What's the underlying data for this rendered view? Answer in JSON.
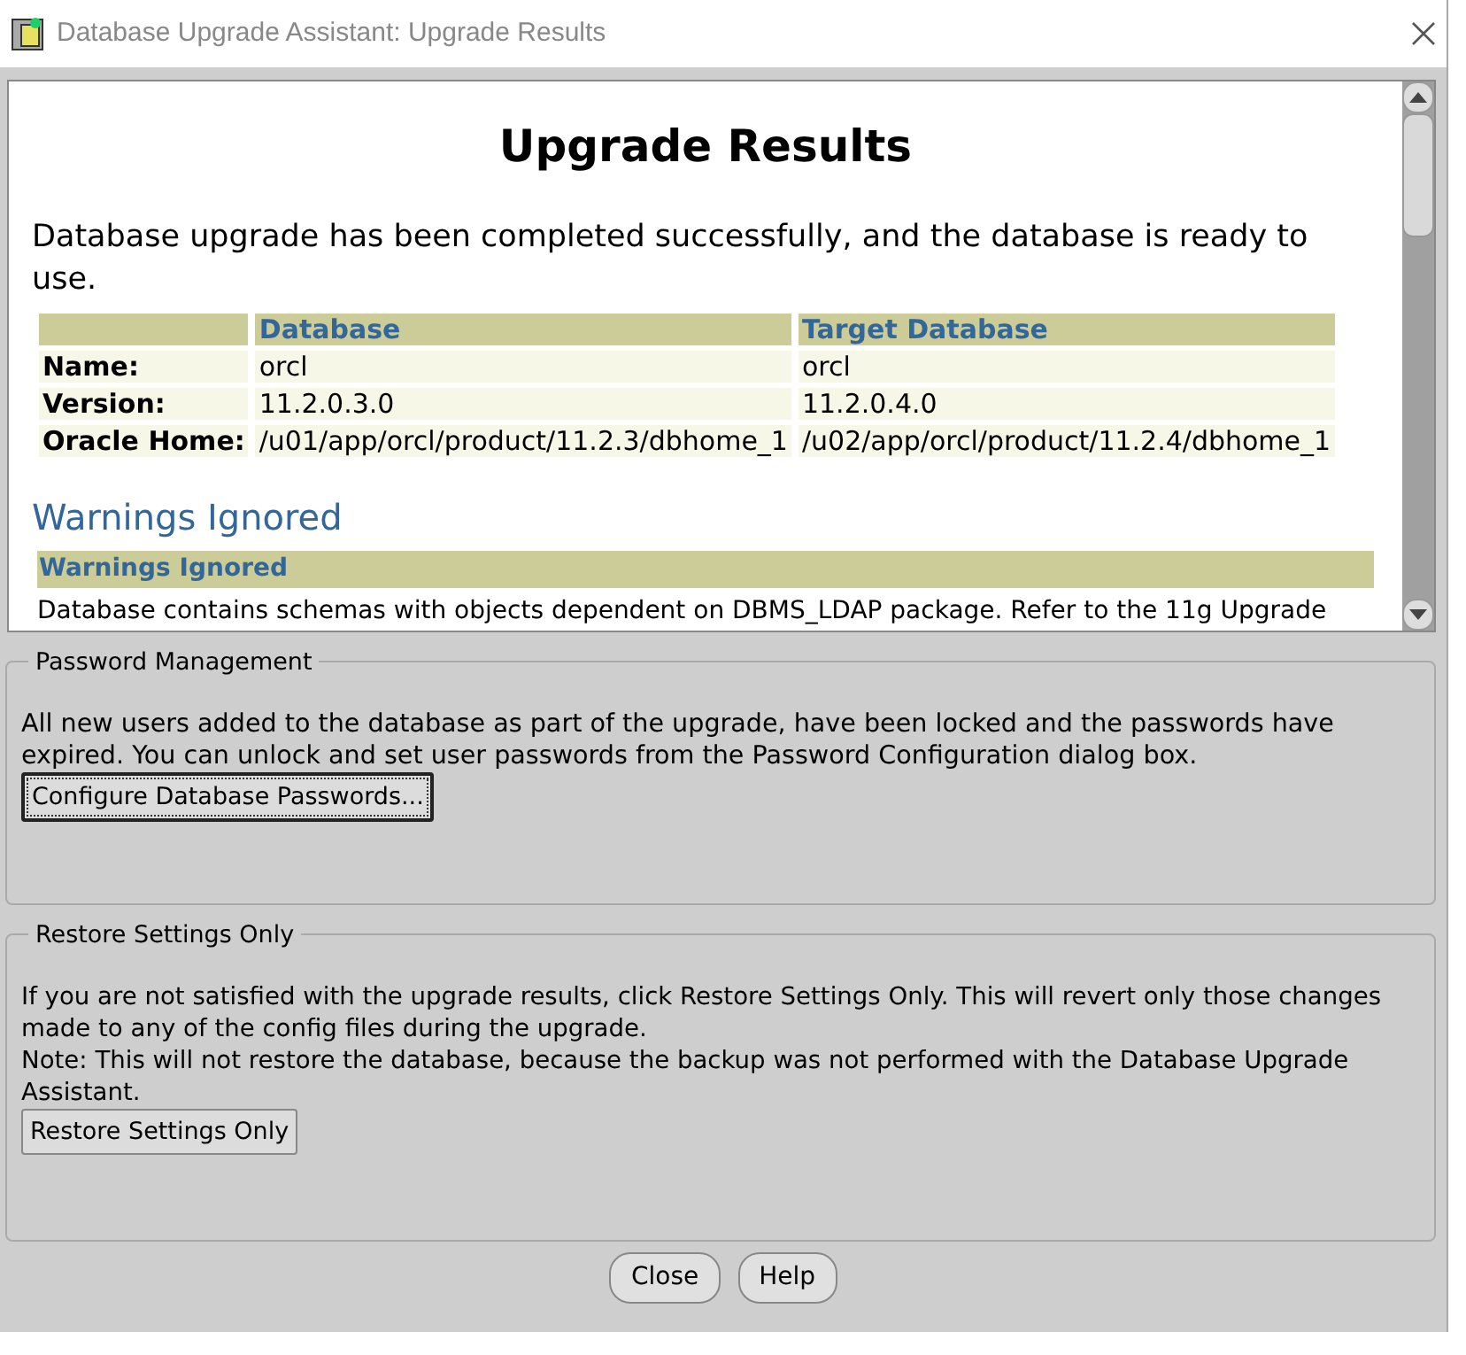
{
  "window": {
    "title": "Database Upgrade Assistant: Upgrade Results"
  },
  "results": {
    "heading": "Upgrade Results",
    "summary": "Database upgrade has been completed successfully, and the database is ready to use.",
    "table": {
      "columns": [
        "Database",
        "Target Database"
      ],
      "rows": [
        {
          "label": "Name:",
          "values": [
            "orcl",
            "orcl"
          ]
        },
        {
          "label": "Version:",
          "values": [
            "11.2.0.3.0",
            "11.2.0.4.0"
          ]
        },
        {
          "label": "Oracle Home:",
          "values": [
            "/u01/app/orcl/product/11.2.3/dbhome_1",
            "/u02/app/orcl/product/11.2.4/dbhome_1"
          ]
        }
      ]
    },
    "warnings": {
      "heading": "Warnings Ignored",
      "table_header": "Warnings Ignored",
      "text": "Database contains schemas with objects dependent on DBMS_LDAP package. Refer to the 11g Upgrade"
    }
  },
  "password_management": {
    "legend": "Password Management",
    "text": "All new users added to the database as part of the upgrade, have been locked and the passwords have expired. You can unlock and set user passwords from the Password Configuration dialog box.",
    "button": {
      "label": "Configure Database Passwords...",
      "focused": true
    }
  },
  "restore_settings": {
    "legend": "Restore Settings Only",
    "paragraphs": [
      "If you are not satisfied with the upgrade results, click Restore Settings Only. This will revert only those changes made to any of the config files during the upgrade.",
      "Note: This will not restore the database, because the backup was not performed with the Database Upgrade Assistant."
    ],
    "button": {
      "label": "Restore Settings Only",
      "focused": false
    }
  },
  "buttons": [
    "Close",
    "Help"
  ]
}
